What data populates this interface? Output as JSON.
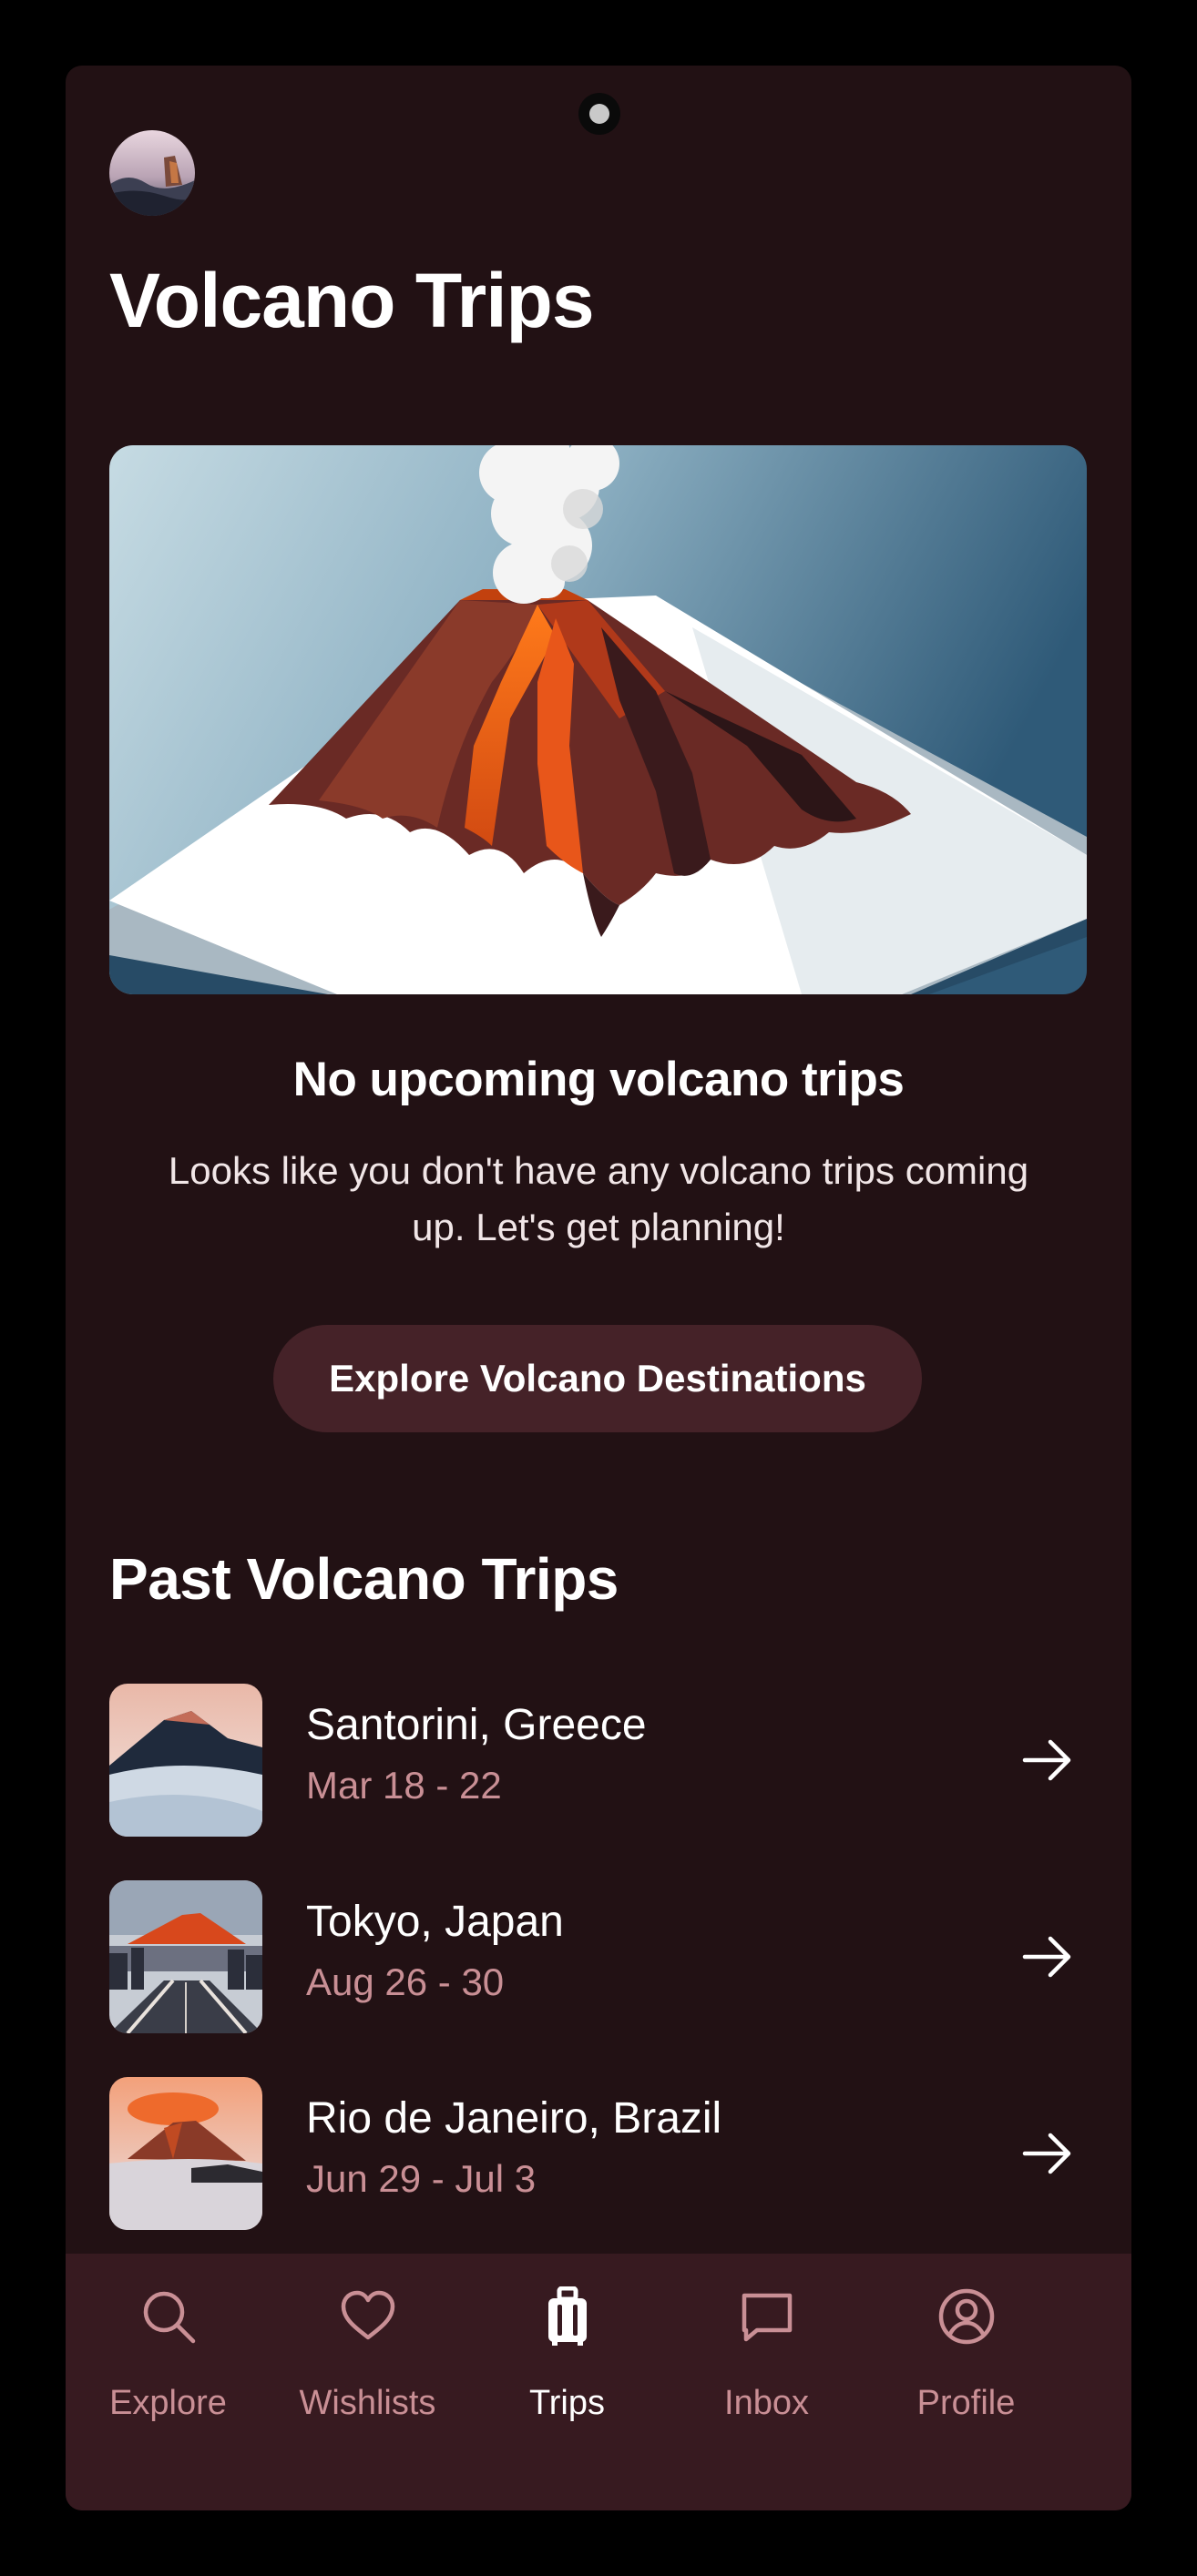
{
  "header": {
    "title": "Volcano Trips"
  },
  "empty_state": {
    "title": "No upcoming volcano trips",
    "body": "Looks like you don't have any volcano trips coming up. Let's get planning!",
    "button_label": "Explore Volcano Destinations"
  },
  "past": {
    "title": "Past Volcano Trips",
    "trips": [
      {
        "name": "Santorini, Greece",
        "dates": "Mar 18 - 22"
      },
      {
        "name": "Tokyo, Japan",
        "dates": "Aug 26 - 30"
      },
      {
        "name": "Rio de Janeiro, Brazil",
        "dates": "Jun 29 - Jul 3"
      }
    ]
  },
  "nav": {
    "items": [
      {
        "label": "Explore",
        "icon": "search-icon"
      },
      {
        "label": "Wishlists",
        "icon": "heart-icon"
      },
      {
        "label": "Trips",
        "icon": "luggage-icon",
        "active": true
      },
      {
        "label": "Inbox",
        "icon": "chat-bubble-icon"
      },
      {
        "label": "Profile",
        "icon": "user-circle-icon"
      }
    ]
  },
  "colors": {
    "background": "#221114",
    "button": "#452228",
    "navbar": "#371a20",
    "muted_text": "#c98f95",
    "accent_lava": "#e8561a"
  }
}
